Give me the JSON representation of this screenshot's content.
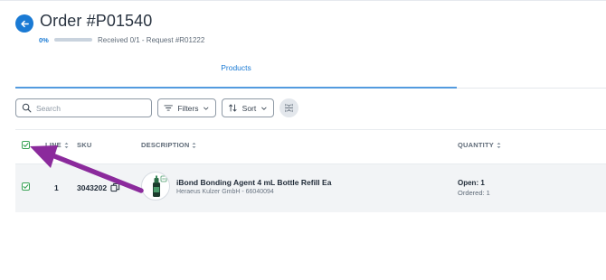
{
  "header": {
    "title": "Order #P01540",
    "progress_percent": 0,
    "progress_label": "0%",
    "progress_text": "Received 0/1 - Request #R01222"
  },
  "tabs": [
    {
      "label": "Products",
      "active": true
    }
  ],
  "toolbar": {
    "search_placeholder": "Search",
    "filters_label": "Filters",
    "sort_label": "Sort"
  },
  "table": {
    "columns": {
      "line": "LINE",
      "sku": "SKU",
      "description": "DESCRIPTION",
      "quantity": "QUANTITY"
    },
    "rows": [
      {
        "checked": true,
        "line": "1",
        "sku": "3043202",
        "name": "iBond Bonding Agent 4 mL Bottle Refill Ea",
        "manufacturer": "Heraeus Kulzer GmbH - 66040094",
        "open": "Open: 1",
        "ordered": "Ordered: 1"
      }
    ]
  },
  "colors": {
    "accent": "#1a7ad4",
    "checkbox": "#3aa357",
    "annotation_arrow": "#8b2a9c"
  },
  "icons": {
    "back": "arrow-left-icon",
    "search": "search-icon",
    "filters": "filter-lines-icon",
    "sort": "sort-arrows-icon",
    "toggle": "expand-collapse-icon",
    "copy": "copy-icon",
    "check": "check-icon",
    "sort_column": "sort-caret-icon"
  }
}
